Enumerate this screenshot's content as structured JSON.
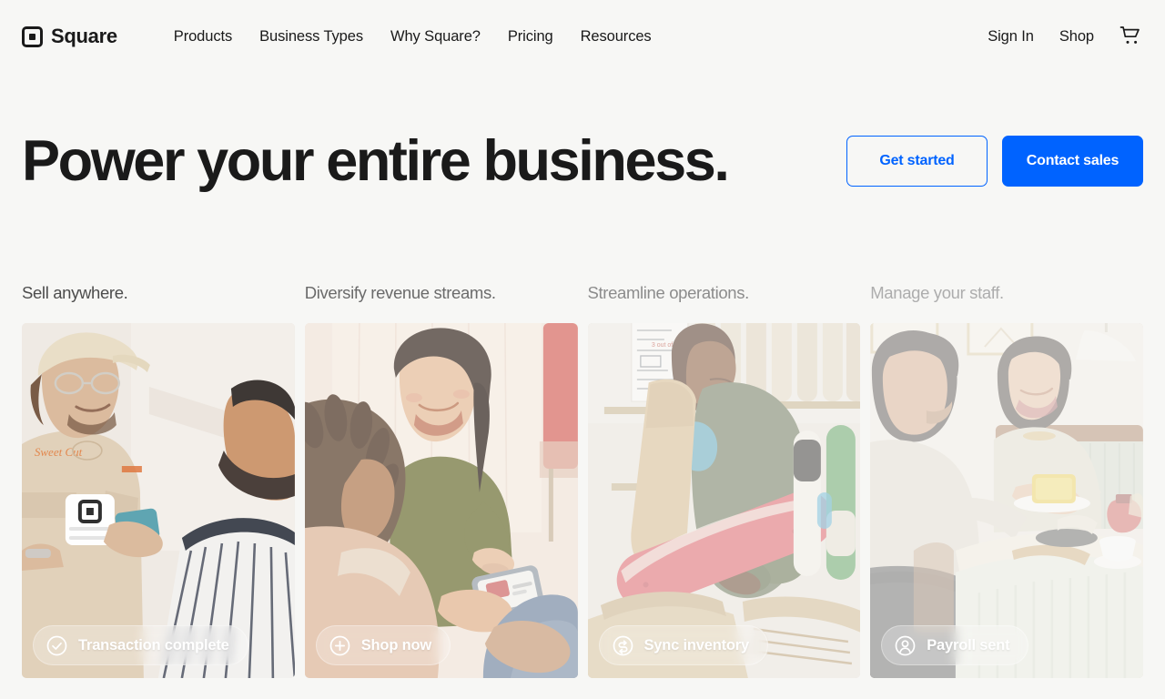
{
  "colors": {
    "page_background": "#f7f7f5",
    "text_primary": "#1a1a1a",
    "accent_blue": "#0063ff",
    "heading_1": "#4d4d4d",
    "heading_2": "#6b6b6b",
    "heading_3": "#8c8c8c",
    "heading_4": "#adadad"
  },
  "header": {
    "brand": {
      "name": "Square",
      "logo_icon": "square-logo-icon"
    },
    "nav": [
      {
        "label": "Products"
      },
      {
        "label": "Business Types"
      },
      {
        "label": "Why Square?"
      },
      {
        "label": "Pricing"
      },
      {
        "label": "Resources"
      }
    ],
    "right": [
      {
        "label": "Sign In"
      },
      {
        "label": "Shop"
      }
    ],
    "cart_icon": "shopping-cart-icon"
  },
  "hero": {
    "title": "Power your entire business.",
    "buttons": [
      {
        "label": "Get started",
        "style": "outline"
      },
      {
        "label": "Contact sales",
        "style": "primary"
      }
    ]
  },
  "cards": [
    {
      "heading": "Sell anywhere.",
      "heading_color": "#4d4d4d",
      "pill_label": "Transaction complete",
      "pill_icon": "check-circle-icon",
      "scene": "barber-handing-square-reader",
      "fade": 0.1
    },
    {
      "heading": "Diversify revenue streams.",
      "heading_color": "#6b6b6b",
      "pill_label": "Shop now",
      "pill_icon": "plus-circle-icon",
      "scene": "two-shoppers-browsing-phone",
      "fade": 0.3
    },
    {
      "heading": "Streamline operations.",
      "heading_color": "#8c8c8c",
      "pill_label": "Sync inventory",
      "pill_icon": "sync-arrows-circle-icon",
      "scene": "skate-shop-stocking-decks",
      "fade": 0.48
    },
    {
      "heading": "Manage your staff.",
      "heading_color": "#adadad",
      "pill_label": "Payroll sent",
      "pill_icon": "person-circle-icon",
      "scene": "cafe-staff-serving-customer",
      "fade": 0.64
    }
  ]
}
